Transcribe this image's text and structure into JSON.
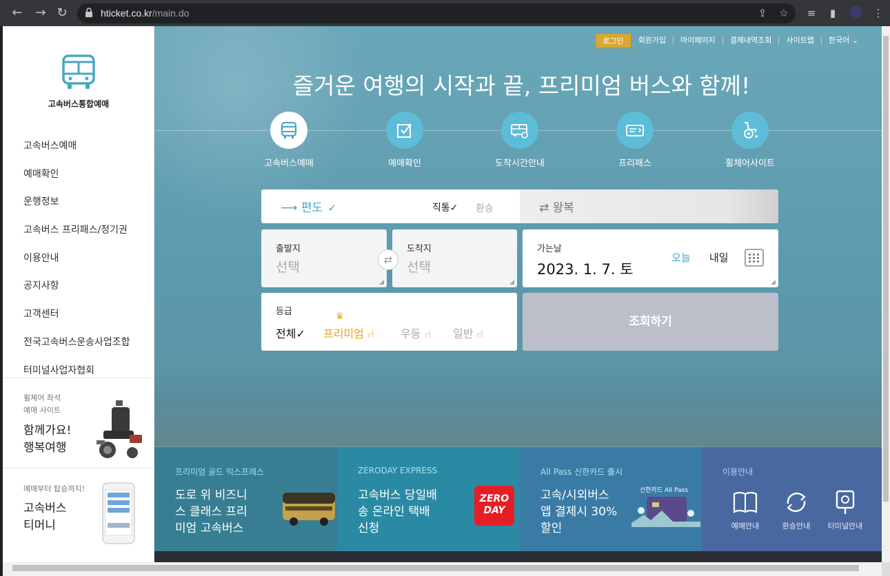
{
  "browser": {
    "url_host": "hticket.co.kr",
    "url_path": "/main.do"
  },
  "sidebar": {
    "logo_text": "고속버스통합예매",
    "menu": [
      "고속버스예매",
      "예매확인",
      "운행정보",
      "고속버스 프리패스/정기권",
      "이용안내",
      "공지사항",
      "고객센터",
      "전국고속버스운송사업조합",
      "터미널사업자협회"
    ],
    "promo_wheelchair": {
      "small": [
        "휠체어 좌석",
        "예매 사이트"
      ],
      "big": [
        "함께가요!",
        "행복여행"
      ]
    },
    "promo_app": {
      "small": "예매부터 탑승까지!",
      "big": [
        "고속버스",
        "티머니"
      ]
    }
  },
  "top_links": {
    "login": "로그인",
    "items": [
      "회원가입",
      "마이페이지",
      "결제내역조회",
      "사이트맵",
      "한국어"
    ]
  },
  "headline": "즐거운 여행의 시작과 끝, 프리미엄 버스와 함께!",
  "services": [
    {
      "label": "고속버스예매",
      "icon": "bus-icon"
    },
    {
      "label": "예매확인",
      "icon": "check-icon"
    },
    {
      "label": "도착시간안내",
      "icon": "bus-clock-icon"
    },
    {
      "label": "프리패스",
      "icon": "pass-icon"
    },
    {
      "label": "휠체어사이트",
      "icon": "wheelchair-icon"
    }
  ],
  "booking": {
    "oneway": "편도",
    "direct": "직통",
    "transfer": "환승",
    "roundtrip": "왕복",
    "departure_label": "출발지",
    "departure_value": "선택",
    "arrival_label": "도착지",
    "arrival_value": "선택",
    "date_label": "가는날",
    "date_value": "2023. 1. 7. 토",
    "today": "오늘",
    "tomorrow": "내일",
    "grade_label": "등급",
    "grades": [
      "전체",
      "프리미엄",
      "우등",
      "일반"
    ],
    "search": "조회하기"
  },
  "banners": [
    {
      "kicker": "프리미엄 골드 익스프레스",
      "copy": [
        "도로 위 비즈니",
        "스 클래스 프리",
        "미엄 고속버스"
      ]
    },
    {
      "kicker": "ZERODAY EXPRESS",
      "copy": [
        "고속버스 당일배",
        "송 온라인 택배",
        "신청"
      ],
      "logo": [
        "ZERO",
        "DAY"
      ]
    },
    {
      "kicker": "All Pass 신한카드 출시",
      "copy": [
        "고속/시외버스",
        "앱 결제시 30%",
        "할인"
      ],
      "card_label": "신한카드 All Pass"
    },
    {
      "kicker": "이용안내",
      "items": [
        "예매안내",
        "환승안내",
        "터미널안내"
      ]
    }
  ],
  "colors": {
    "accent_blue": "#4aa6c4",
    "login_gold": "#d9a733",
    "premium_gold": "#e8a317",
    "search_disabled": "#bcbfca"
  }
}
